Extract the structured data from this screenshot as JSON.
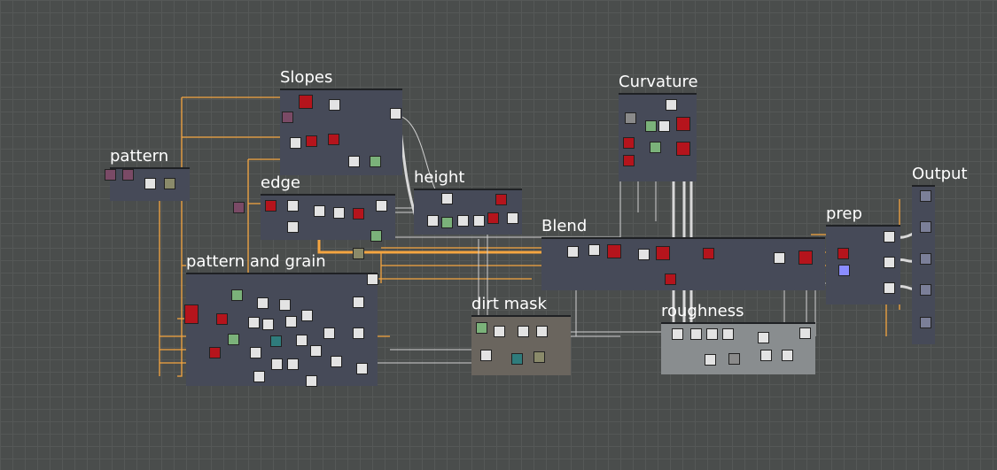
{
  "frames": {
    "slopes": "Slopes",
    "pattern": "pattern",
    "edge": "edge",
    "height": "height",
    "curvature": "Curvature",
    "output": "Output",
    "prep": "prep",
    "blend": "Blend",
    "pattern_grain": "pattern and grain",
    "dirt_mask": "dirt mask",
    "roughness": "roughness"
  },
  "colors": {
    "canvas": "#4a4d4c",
    "frame": "#464a58",
    "wire_orange": "#f5a540",
    "wire_white": "#d8d8d8",
    "node_red": "#b5141c",
    "node_white": "#e3e3e3"
  }
}
